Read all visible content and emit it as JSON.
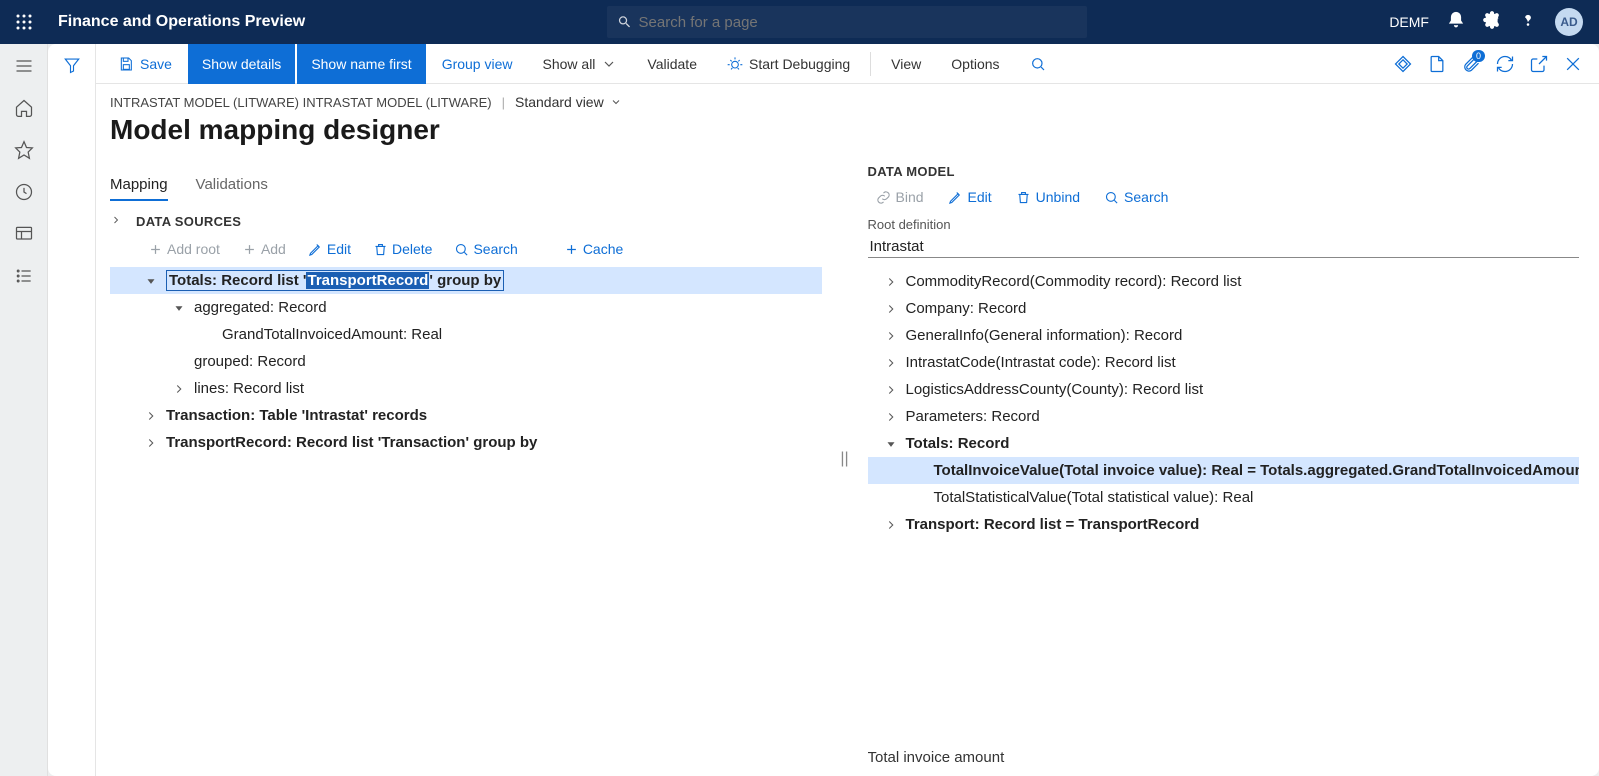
{
  "topbar": {
    "app_title": "Finance and Operations Preview",
    "search_placeholder": "Search for a page",
    "company": "DEMF",
    "avatar": "AD"
  },
  "cmdbar": {
    "save": "Save",
    "show_details": "Show details",
    "show_name_first": "Show name first",
    "group_view": "Group view",
    "show_all": "Show all",
    "validate": "Validate",
    "start_debugging": "Start Debugging",
    "view": "View",
    "options": "Options",
    "attach_count": "0"
  },
  "crumbs": {
    "path": "INTRASTAT MODEL (LITWARE) INTRASTAT MODEL (LITWARE)",
    "view": "Standard view"
  },
  "page_title": "Model mapping designer",
  "tabs": {
    "mapping": "Mapping",
    "validations": "Validations"
  },
  "ds": {
    "header": "DATA SOURCES",
    "tools": {
      "add_root": "Add root",
      "add": "Add",
      "edit": "Edit",
      "delete": "Delete",
      "search": "Search",
      "cache": "Cache"
    },
    "node0_pre": "Totals: Record list '",
    "node0_hl": "TransportRecord",
    "node0_post": "' group by",
    "node1": "aggregated: Record",
    "node2": "GrandTotalInvoicedAmount: Real",
    "node3": "grouped: Record",
    "node4": "lines: Record list",
    "node5": "Transaction: Table 'Intrastat' records",
    "node6": "TransportRecord: Record list 'Transaction' group by"
  },
  "dm": {
    "header": "DATA MODEL",
    "tools": {
      "bind": "Bind",
      "edit": "Edit",
      "unbind": "Unbind",
      "search": "Search"
    },
    "root_label": "Root definition",
    "root_value": "Intrastat",
    "n0": "CommodityRecord(Commodity record): Record list",
    "n1": "Company: Record",
    "n2": "GeneralInfo(General information): Record",
    "n3": "IntrastatCode(Intrastat code): Record list",
    "n4": "LogisticsAddressCounty(County): Record list",
    "n5": "Parameters: Record",
    "n6": "Totals: Record",
    "n7": "TotalInvoiceValue(Total invoice value): Real = Totals.aggregated.GrandTotalInvoicedAmount",
    "n8": "TotalStatisticalValue(Total statistical value): Real",
    "n9": "Transport: Record list = TransportRecord"
  },
  "footer": "Total invoice amount"
}
